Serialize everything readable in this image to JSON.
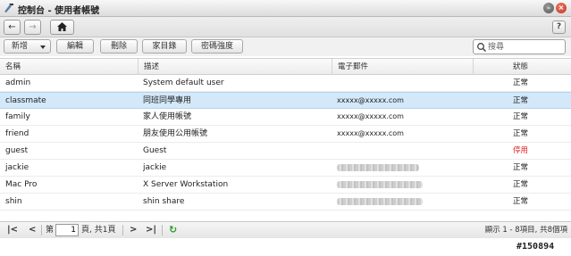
{
  "window": {
    "title": "控制台 - 使用者帳號"
  },
  "nav": {
    "back_icon": "arrow-left-icon",
    "forward_icon": "arrow-right-icon",
    "home_icon": "home-icon",
    "help_label": "?"
  },
  "toolbar": {
    "new_label": "新增",
    "edit_label": "編輯",
    "delete_label": "刪除",
    "home_folder_label": "家目錄",
    "password_strength_label": "密碼強度",
    "search_placeholder": "搜尋"
  },
  "columns": {
    "name": "名稱",
    "description": "描述",
    "email": "電子郵件",
    "status": "狀態"
  },
  "rows": [
    {
      "name": "admin",
      "description": "System default user",
      "email": "",
      "email_obscured": false,
      "status": "正常",
      "status_kind": "normal",
      "selected": false
    },
    {
      "name": "classmate",
      "description": "同班同學專用",
      "email": "xxxxx@xxxxx.com",
      "email_obscured": false,
      "status": "正常",
      "status_kind": "normal",
      "selected": true
    },
    {
      "name": "family",
      "description": "家人使用帳號",
      "email": "xxxxx@xxxxx.com",
      "email_obscured": false,
      "status": "正常",
      "status_kind": "normal",
      "selected": false
    },
    {
      "name": "friend",
      "description": "朋友使用公用帳號",
      "email": "xxxxx@xxxxx.com",
      "email_obscured": false,
      "status": "正常",
      "status_kind": "normal",
      "selected": false
    },
    {
      "name": "guest",
      "description": "Guest",
      "email": "",
      "email_obscured": false,
      "status": "停用",
      "status_kind": "disabled",
      "selected": false
    },
    {
      "name": "jackie",
      "description": "jackie",
      "email": "",
      "email_obscured": true,
      "status": "正常",
      "status_kind": "normal",
      "selected": false
    },
    {
      "name": "Mac Pro",
      "description": "X Server Workstation",
      "email": "",
      "email_obscured": true,
      "status": "正常",
      "status_kind": "normal",
      "selected": false
    },
    {
      "name": "shin",
      "description": "shin share",
      "email": "",
      "email_obscured": true,
      "status": "正常",
      "status_kind": "normal",
      "selected": false
    }
  ],
  "pager": {
    "page_prefix": "第",
    "current_page": "1",
    "page_suffix": "頁, 共1頁",
    "info": "顯示 1 - 8項目, 共8個項目"
  },
  "watermark": "#150894",
  "colors": {
    "selected_row": "#d3e8f8",
    "disabled_status": "#dd2222",
    "refresh_icon": "#2f9a2f",
    "close_button": "#c0311d"
  }
}
